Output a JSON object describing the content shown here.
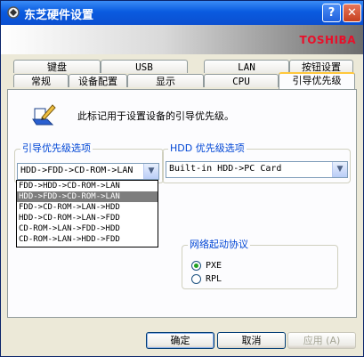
{
  "window": {
    "title": "东芝硬件设置",
    "help_button": "?",
    "close_button": "✕"
  },
  "banner": {
    "brand": "TOSHIBA"
  },
  "tabs_back": [
    {
      "label": "键盘"
    },
    {
      "label": "USB"
    },
    {
      "label": "LAN"
    },
    {
      "label": "按钮设置"
    }
  ],
  "tabs_front": [
    {
      "label": "常规"
    },
    {
      "label": "设备配置"
    },
    {
      "label": "显示"
    },
    {
      "label": "CPU"
    },
    {
      "label": "引导优先级"
    }
  ],
  "panel": {
    "description": "此标记用于设置设备的引导优先级。",
    "boot_group": {
      "legend": "引导优先级选项",
      "selected": "HDD->FDD->CD-ROM->LAN",
      "options": [
        "FDD->HDD->CD-ROM->LAN",
        "HDD->FDD->CD-ROM->LAN",
        "FDD->CD-ROM->LAN->HDD",
        "HDD->CD-ROM->LAN->FDD",
        "CD-ROM->LAN->FDD->HDD",
        "CD-ROM->LAN->HDD->FDD"
      ],
      "highlighted_index": 1
    },
    "hdd_group": {
      "legend": "HDD 优先级选项",
      "selected": "Built-in HDD->PC Card"
    },
    "network_group": {
      "legend": "网络起动协议",
      "options": [
        {
          "label": "PXE",
          "checked": true
        },
        {
          "label": "RPL",
          "checked": false
        }
      ]
    }
  },
  "buttons": {
    "ok": "确定",
    "cancel": "取消",
    "apply": "应用 (A)"
  }
}
